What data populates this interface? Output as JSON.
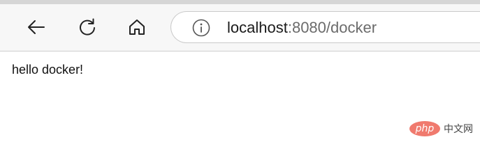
{
  "toolbar": {
    "back_icon": "arrow-left-icon",
    "reload_icon": "reload-icon",
    "home_icon": "home-icon"
  },
  "address_bar": {
    "info_icon": "info-icon",
    "url_host": "localhost",
    "url_rest": ":8080/docker"
  },
  "page": {
    "content_text": "hello docker!"
  },
  "watermark": {
    "logo_text": "php",
    "site_text": "中文网",
    "logo_color": "#f07a6e"
  }
}
